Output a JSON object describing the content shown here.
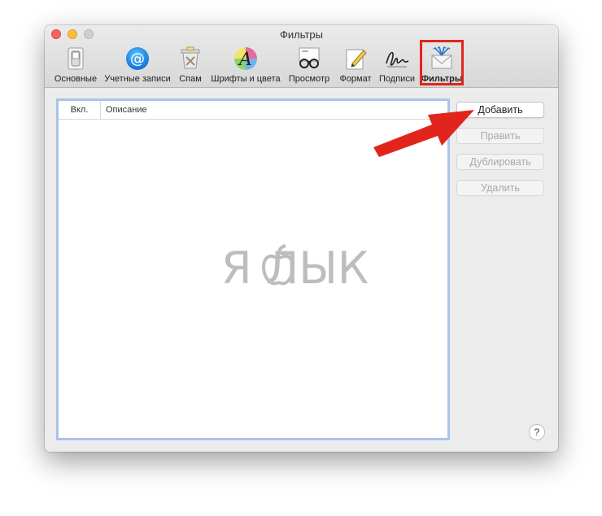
{
  "window": {
    "title": "Фильтры"
  },
  "toolbar": {
    "items": [
      {
        "label": "Основные",
        "icon": "switch-icon"
      },
      {
        "label": "Учетные записи",
        "icon": "at-icon"
      },
      {
        "label": "Спам",
        "icon": "junk-bin-icon"
      },
      {
        "label": "Шрифты и цвета",
        "icon": "font-colors-icon"
      },
      {
        "label": "Просмотр",
        "icon": "glasses-icon"
      },
      {
        "label": "Формат",
        "icon": "compose-icon"
      },
      {
        "label": "Подписи",
        "icon": "signature-icon"
      },
      {
        "label": "Фильтры",
        "icon": "rules-envelope-icon",
        "selected": true
      }
    ]
  },
  "rules_list": {
    "columns": [
      "Вкл.",
      "Описание"
    ]
  },
  "buttons": {
    "add": "Добавить",
    "edit": "Править",
    "duplicate": "Дублировать",
    "delete": "Удалить"
  },
  "help": "?",
  "watermark": {
    "text": "Я  ЛЫК"
  },
  "colors": {
    "highlight": "#e2251c",
    "arrow": "#e2251c",
    "list_focus_border": "#a7c5e8"
  }
}
